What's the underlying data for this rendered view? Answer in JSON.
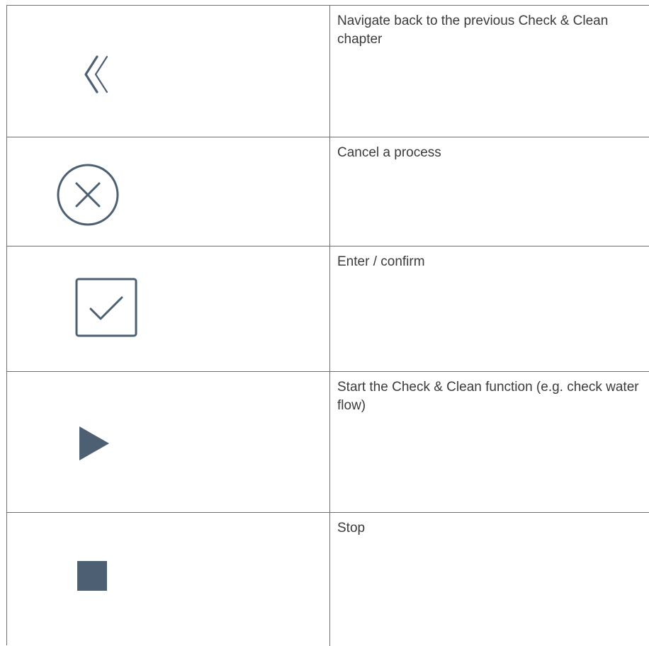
{
  "legend_table": {
    "rows": [
      {
        "icon": "double-chevron-left-icon",
        "description": "Navigate back to the previous Check & Clean chapter"
      },
      {
        "icon": "circle-x-icon",
        "description": "Cancel a process"
      },
      {
        "icon": "checkbox-check-icon",
        "description": "Enter / confirm"
      },
      {
        "icon": "play-icon",
        "description": "Start the Check & Clean function (e.g. check water flow)"
      },
      {
        "icon": "stop-icon",
        "description": "Stop"
      }
    ]
  },
  "colors": {
    "icon": "#4d5f73",
    "text": "#3b3b3b",
    "border": "#6f6f6f"
  }
}
